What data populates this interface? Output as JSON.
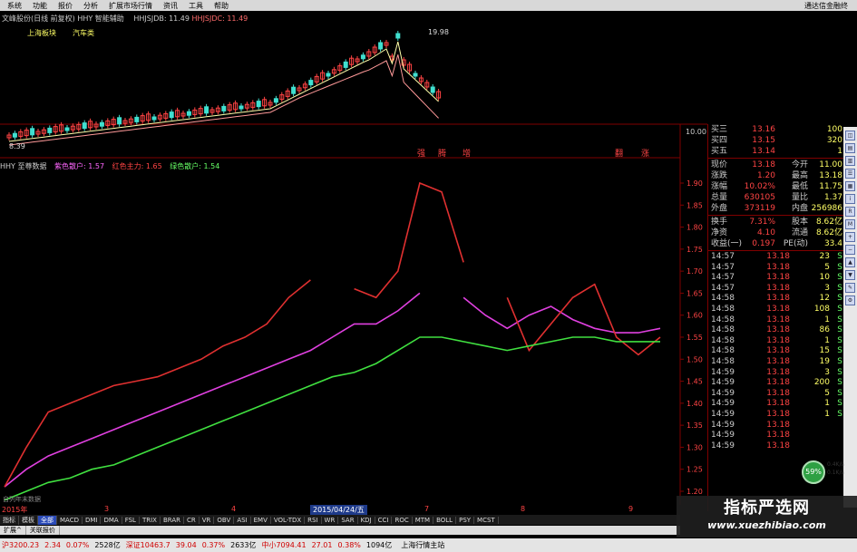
{
  "menu": [
    "系统",
    "功能",
    "报价",
    "分析",
    "扩展市场行情",
    "资讯",
    "工具",
    "帮助"
  ],
  "brand": "通达信金融终",
  "stock_header": {
    "name": "文峰股份(日线 前复权)",
    "indicator": "HHY 智能辅助",
    "f1": "HHJSJDB: 11.49",
    "f2": "HHJSJDC: 11.49"
  },
  "tags": [
    "上海板块",
    "汽车类"
  ],
  "candle_labels": {
    "high": "19.98",
    "low": "8.39"
  },
  "upper_right_price": "10.00",
  "signal_marks": [
    "强",
    "腾",
    "增",
    "翻",
    "涨"
  ],
  "indicator_header": {
    "name": "HHY 至尊数据",
    "l1": "紫色散户: 1.57",
    "l2": "红色主力: 1.65",
    "l3": "绿色散户: 1.54"
  },
  "y_axis_ticks": [
    "1.90",
    "1.85",
    "1.80",
    "1.75",
    "1.70",
    "1.65",
    "1.60",
    "1.55",
    "1.50",
    "1.45",
    "1.40",
    "1.35",
    "1.30",
    "1.25",
    "1.20"
  ],
  "quote_top": [
    {
      "l": "买三",
      "p": "13.16",
      "v": "100"
    },
    {
      "l": "买四",
      "p": "13.15",
      "v": "320"
    },
    {
      "l": "买五",
      "p": "13.14",
      "v": "1"
    }
  ],
  "quote_stats": [
    {
      "a": "现价",
      "b": "13.18",
      "c": "今开",
      "d": "11.00"
    },
    {
      "a": "涨跌",
      "b": "1.20",
      "c": "最高",
      "d": "13.18"
    },
    {
      "a": "涨幅",
      "b": "10.02%",
      "c": "最低",
      "d": "11.75"
    },
    {
      "a": "总量",
      "b": "630105",
      "c": "量比",
      "d": "1.37"
    },
    {
      "a": "外盘",
      "b": "373119",
      "c": "内盘",
      "d": "256986"
    }
  ],
  "quote_stats2": [
    {
      "a": "换手",
      "b": "7.31%",
      "c": "股本",
      "d": "8.62亿"
    },
    {
      "a": "净资",
      "b": "4.10",
      "c": "流通",
      "d": "8.62亿"
    },
    {
      "a": "收益(一)",
      "b": "0.197",
      "c": "PE(动)",
      "d": "33.4"
    }
  ],
  "ticks": [
    {
      "t": "14:57",
      "p": "13.18",
      "v": "23",
      "s": "S"
    },
    {
      "t": "14:57",
      "p": "13.18",
      "v": "5",
      "s": "S"
    },
    {
      "t": "14:57",
      "p": "13.18",
      "v": "10",
      "s": "S"
    },
    {
      "t": "14:57",
      "p": "13.18",
      "v": "3",
      "s": "S"
    },
    {
      "t": "14:58",
      "p": "13.18",
      "v": "12",
      "s": "S"
    },
    {
      "t": "14:58",
      "p": "13.18",
      "v": "108",
      "s": "S"
    },
    {
      "t": "14:58",
      "p": "13.18",
      "v": "1",
      "s": "S"
    },
    {
      "t": "14:58",
      "p": "13.18",
      "v": "86",
      "s": "S"
    },
    {
      "t": "14:58",
      "p": "13.18",
      "v": "1",
      "s": "S"
    },
    {
      "t": "14:58",
      "p": "13.18",
      "v": "15",
      "s": "S"
    },
    {
      "t": "14:58",
      "p": "13.18",
      "v": "19",
      "s": "S"
    },
    {
      "t": "14:59",
      "p": "13.18",
      "v": "3",
      "s": "S"
    },
    {
      "t": "14:59",
      "p": "13.18",
      "v": "200",
      "s": "S"
    },
    {
      "t": "14:59",
      "p": "13.18",
      "v": "5",
      "s": "S"
    },
    {
      "t": "14:59",
      "p": "13.18",
      "v": "1",
      "s": "S"
    },
    {
      "t": "14:59",
      "p": "13.18",
      "v": "1",
      "s": "S"
    },
    {
      "t": "14:59",
      "p": "13.18",
      "v": "",
      "s": ""
    },
    {
      "t": "14:59",
      "p": "13.18",
      "v": "",
      "s": ""
    },
    {
      "t": "14:59",
      "p": "13.18",
      "v": "",
      "s": ""
    }
  ],
  "gauge": {
    "pct": "59%",
    "up": "0.4K/s",
    "down": "0.1K/s"
  },
  "date_bar": {
    "d0": "2015年",
    "d1": "3",
    "d2": "4",
    "hl": "2015/04/24/五",
    "d3": "7",
    "d4": "8",
    "d5": "9"
  },
  "bottom_left_label": "自列年末数据",
  "ind_tabs": [
    "指标",
    "模板",
    "全部",
    "MACD",
    "DMI",
    "DMA",
    "FSL",
    "TRIX",
    "BRAR",
    "CR",
    "VR",
    "OBV",
    "ASI",
    "EMV",
    "VOL-TDX",
    "RSI",
    "WR",
    "SAR",
    "KDJ",
    "CCI",
    "ROC",
    "MTM",
    "BOLL",
    "PSY",
    "MCST"
  ],
  "sub_tabs": [
    "扩展^",
    "关联报价"
  ],
  "status": {
    "s1": "沪3200.23",
    "s2": "2.34",
    "s3": "0.07%",
    "s4": "2528亿",
    "s5": "深证10463.7",
    "s6": "39.04",
    "s7": "0.37%",
    "s8": "2633亿",
    "s9": "中小7094.41",
    "s10": "27.01",
    "s11": "0.38%",
    "s12": "1094亿",
    "s13": "上海行情主站"
  },
  "watermark": {
    "title": "指标严选网",
    "url": "www.xuezhibiao.com"
  },
  "colors": {
    "purple": "#e040e0",
    "red": "#e03030",
    "green": "#40e040",
    "up_candle": "#ff4444",
    "down_candle": "#40e0d0"
  },
  "chart_data": {
    "type": "line",
    "title": "HHY 至尊数据",
    "ylim": [
      1.2,
      1.92
    ],
    "series": [
      {
        "name": "紫色散户",
        "values": [
          1.21,
          1.25,
          1.28,
          1.3,
          1.32,
          1.34,
          1.36,
          1.38,
          1.4,
          1.42,
          1.44,
          1.46,
          1.48,
          1.5,
          1.52,
          1.55,
          1.58,
          1.58,
          1.61,
          1.65,
          null,
          1.64,
          1.6,
          1.57,
          1.6,
          1.62,
          1.59,
          1.57,
          1.56,
          1.56,
          1.57
        ]
      },
      {
        "name": "红色主力",
        "values": [
          1.21,
          1.3,
          1.38,
          1.4,
          1.42,
          1.44,
          1.45,
          1.46,
          1.48,
          1.5,
          1.53,
          1.55,
          1.58,
          1.64,
          1.68,
          null,
          1.66,
          1.64,
          1.7,
          1.9,
          1.88,
          1.72,
          null,
          1.64,
          1.52,
          1.58,
          1.64,
          1.67,
          1.55,
          1.51,
          1.55
        ]
      },
      {
        "name": "绿色散户",
        "values": [
          1.18,
          1.2,
          1.22,
          1.23,
          1.25,
          1.26,
          1.28,
          1.3,
          1.32,
          1.34,
          1.36,
          1.38,
          1.4,
          1.42,
          1.44,
          1.46,
          1.47,
          1.49,
          1.52,
          1.55,
          1.55,
          1.54,
          1.53,
          1.52,
          1.53,
          1.54,
          1.55,
          1.55,
          1.54,
          1.54,
          1.54
        ]
      }
    ]
  }
}
